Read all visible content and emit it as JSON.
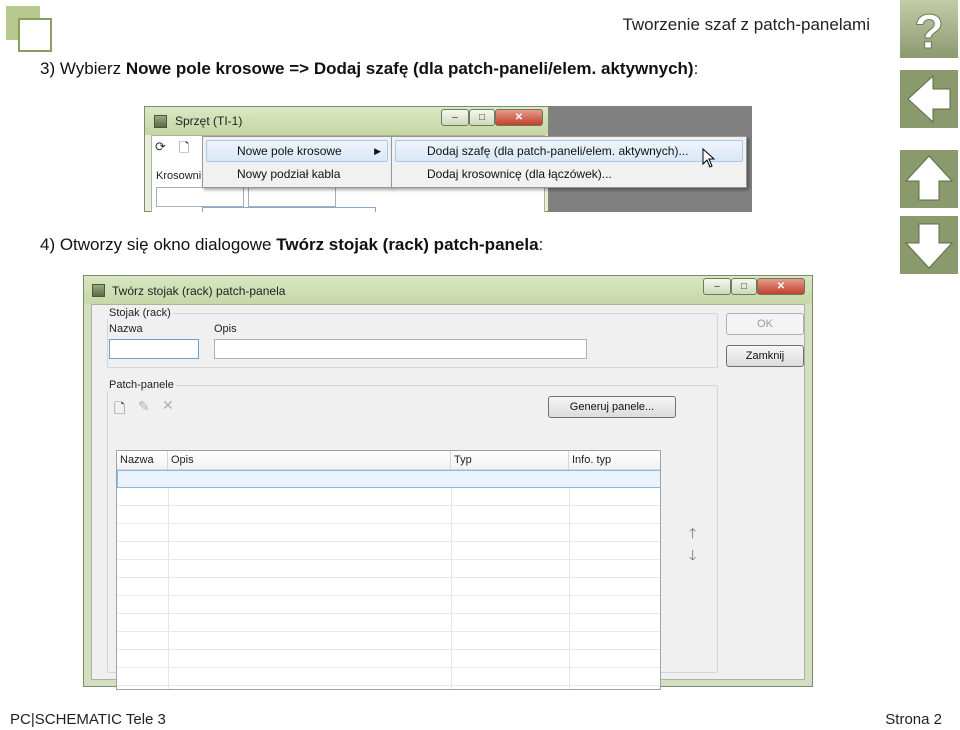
{
  "header": {
    "title": "Tworzenie szaf z patch-panelami",
    "brand_color": "#b7c98f"
  },
  "nav": {
    "help_label": "?",
    "icons": [
      "help-icon",
      "back-arrow-icon",
      "up-arrow-icon",
      "down-arrow-icon"
    ]
  },
  "steps": {
    "s3": {
      "prefix": "3) Wybierz ",
      "bold": "Nowe pole krosowe => Dodaj szafę (dla patch-paneli/elem. aktywnych)",
      "suffix": ":"
    },
    "s4": {
      "prefix": "4) Otworzy się okno dialogowe ",
      "bold": "Twórz stojak (rack) patch-panela",
      "suffix": ":"
    }
  },
  "shot1": {
    "window_title": "Sprzęt (TI-1)",
    "label_partial": "Krosowni",
    "menu": {
      "items": [
        {
          "label": "Nowe pole krosowe",
          "highlighted": true,
          "submenu": true
        },
        {
          "label": "Nowy podział kabla",
          "highlighted": false
        }
      ],
      "submenu_items": [
        {
          "label": "Dodaj szafę (dla patch-paneli/elem. aktywnych)...",
          "highlighted": true
        },
        {
          "label": "Dodaj krosownicę (dla łączówek)...",
          "highlighted": false
        }
      ]
    }
  },
  "dialog": {
    "title": "Twórz stojak (rack) patch-panela",
    "group_rack": "Stojak (rack)",
    "label_name": "Nazwa",
    "label_desc": "Opis",
    "value_name": "",
    "value_desc": "",
    "ok_label": "OK",
    "close_label": "Zamknij",
    "group_panels": "Patch-panele",
    "generate_label": "Generuj panele...",
    "columns": [
      "Nazwa",
      "Opis",
      "Typ",
      "Info. typ"
    ],
    "rows": []
  },
  "footer": {
    "left": "PC|SCHEMATIC Tele 3",
    "right": "Strona 2"
  }
}
